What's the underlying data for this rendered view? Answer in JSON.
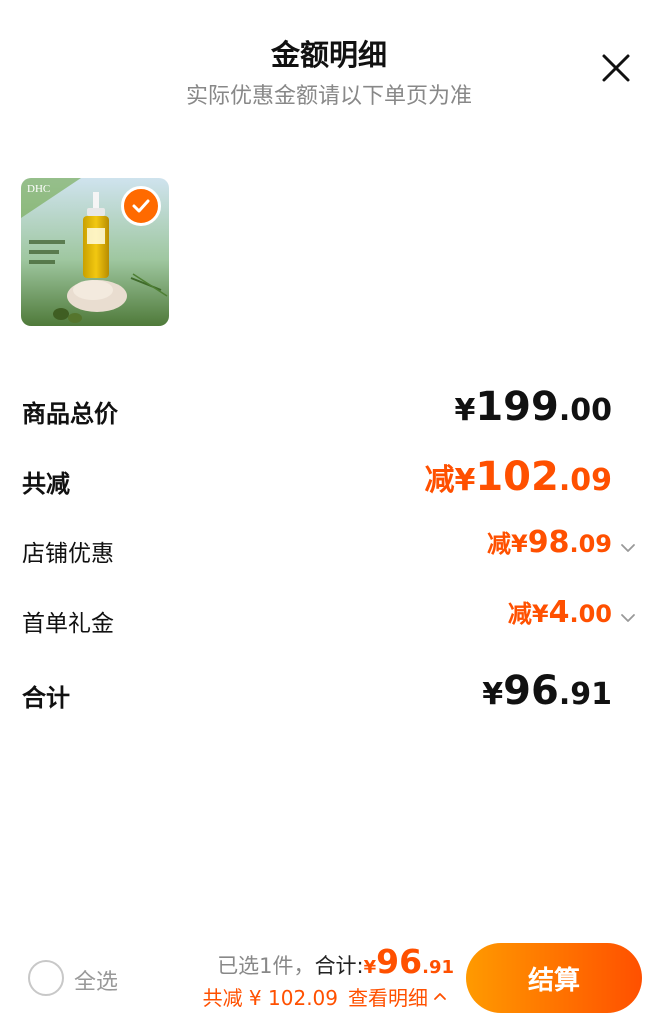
{
  "header": {
    "title": "金额明细",
    "subtitle": "实际优惠金额请以下单页为准"
  },
  "product": {
    "brand_text": "DHC",
    "selected": true
  },
  "breakdown": {
    "goods_total": {
      "label": "商品总价",
      "yen": "¥",
      "int": "199",
      "dec": ".00"
    },
    "total_discount": {
      "label": "共减",
      "prefix": "减",
      "yen": "¥",
      "int": "102",
      "dec": ".09"
    },
    "shop_discount": {
      "label": "店铺优惠",
      "prefix": "减",
      "yen": "¥",
      "int": "98",
      "dec": ".09"
    },
    "first_order_gift": {
      "label": "首单礼金",
      "prefix": "减",
      "yen": "¥",
      "int": "4",
      "dec": ".00"
    },
    "total": {
      "label": "合计",
      "yen": "¥",
      "int": "96",
      "dec": ".91"
    }
  },
  "footer": {
    "select_all_label": "全选",
    "selected_count_text": "已选1件，",
    "total_label": "合计: ",
    "total_yen": "¥",
    "total_int": "96",
    "total_dec": ".91",
    "discount_text": "共减 ¥ 102.09",
    "view_detail_label": "查看明细",
    "checkout_label": "结算"
  },
  "colors": {
    "accent": "#ff5000",
    "accent_gradient_start": "#ff9a00",
    "text": "#111111",
    "subtext": "#888888"
  },
  "icons": {
    "close": "close-icon",
    "check": "check-icon",
    "chevron_down": "chevron-down-icon",
    "chevron_up": "chevron-up-icon"
  }
}
